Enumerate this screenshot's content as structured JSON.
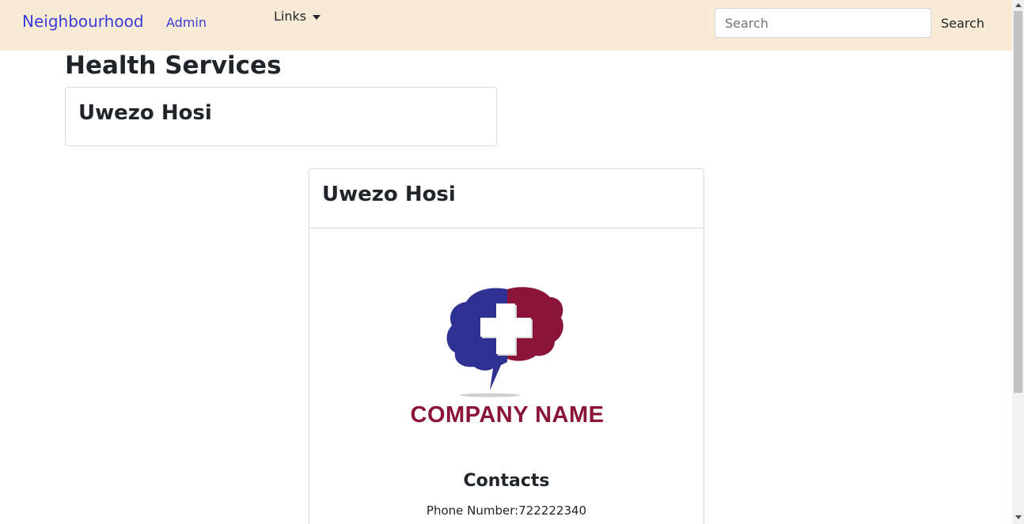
{
  "navbar": {
    "brand": "Neighbourhood",
    "admin_link": "Admin",
    "links_dropdown": "Links",
    "search_placeholder": "Search",
    "search_button": "Search"
  },
  "page": {
    "title": "Health Services"
  },
  "services": [
    {
      "name": "Uwezo Hosi"
    }
  ],
  "detail": {
    "title": "Uwezo Hosi",
    "logo_text": "COMPANY NAME",
    "contacts_heading": "Contacts",
    "phone": "Phone Number:722222340"
  },
  "colors": {
    "navbar_bg": "#f8ebd6",
    "link": "#3b3bd8",
    "logo_blue": "#2e3192",
    "logo_red": "#8b1538"
  },
  "icons": {
    "dropdown": "caret-down-icon",
    "logo": "brain-medical-cross-logo"
  }
}
